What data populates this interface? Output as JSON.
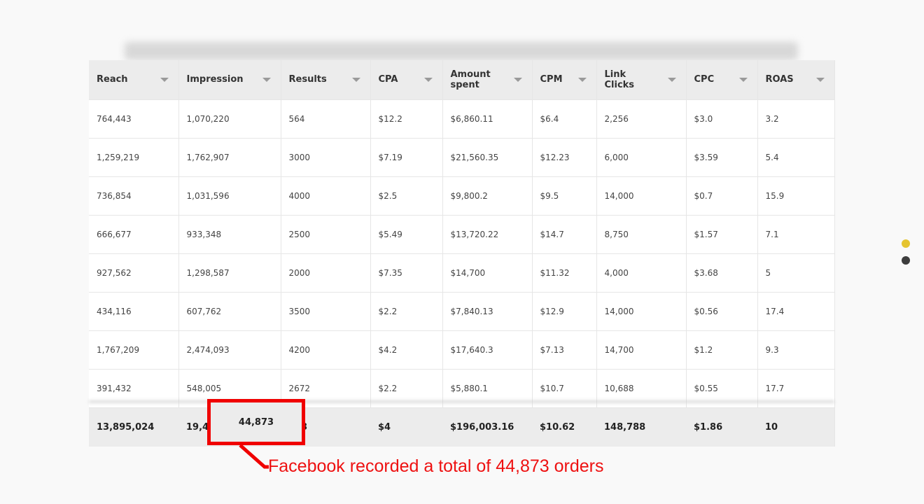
{
  "table": {
    "columns": [
      "Reach",
      "Impression",
      "Results",
      "CPA",
      "Amount\nspent",
      "CPM",
      "Link\nClicks",
      "CPC",
      "ROAS"
    ],
    "rows": [
      [
        "764,443",
        "1,070,220",
        "564",
        "$12.2",
        "$6,860.11",
        "$6.4",
        "2,256",
        "$3.0",
        "3.2"
      ],
      [
        "1,259,219",
        "1,762,907",
        "3000",
        "$7.19",
        "$21,560.35",
        "$12.23",
        "6,000",
        "$3.59",
        "5.4"
      ],
      [
        "736,854",
        "1,031,596",
        "4000",
        "$2.5",
        "$9,800.2",
        "$9.5",
        "14,000",
        "$0.7",
        "15.9"
      ],
      [
        "666,677",
        "933,348",
        "2500",
        "$5.49",
        "$13,720.22",
        "$14.7",
        "8,750",
        "$1.57",
        "7.1"
      ],
      [
        "927,562",
        "1,298,587",
        "2000",
        "$7.35",
        "$14,700",
        "$11.32",
        "4,000",
        "$3.68",
        "5"
      ],
      [
        "434,116",
        "607,762",
        "3500",
        "$2.2",
        "$7,840.13",
        "$12.9",
        "14,000",
        "$0.56",
        "17.4"
      ],
      [
        "1,767,209",
        "2,474,093",
        "4200",
        "$4.2",
        "$17,640.3",
        "$7.13",
        "14,700",
        "$1.2",
        "9.3"
      ],
      [
        "391,432",
        "548,005",
        "2672",
        "$2.2",
        "$5,880.1",
        "$10.7",
        "10,688",
        "$0.55",
        "17.7"
      ]
    ],
    "totals": [
      "13,895,024",
      "19,45",
      "373",
      "$4",
      "$196,003.16",
      "$10.62",
      "148,788",
      "$1.86",
      "10"
    ]
  },
  "callout": {
    "value": "44,873",
    "text": "Facebook recorded a total of 44,873 orders",
    "color": "#f00000"
  },
  "pager": {
    "dots": [
      {
        "state": "active",
        "color": "#e5c430"
      },
      {
        "state": "inactive",
        "color": "#3d3d3d"
      }
    ]
  }
}
